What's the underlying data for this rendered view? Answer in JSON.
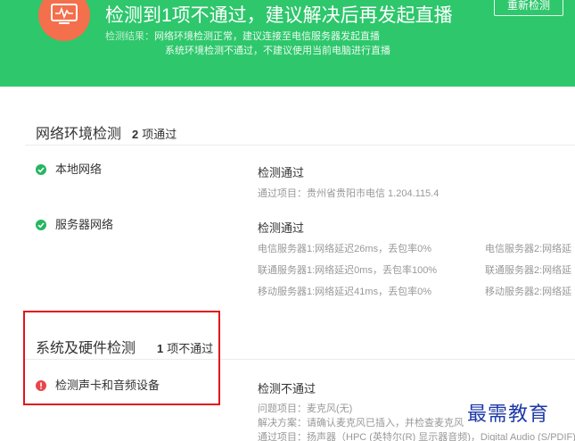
{
  "banner": {
    "title": "检测到1项不通过，建议解决后再发起直播",
    "result_label": "检测结果：",
    "result_line1": "网络环境检测正常，建议连接至电信服务器发起直播",
    "result_line2": "系统环境检测不通过，不建议使用当前电脑进行直播",
    "recheck_button": "重新检测",
    "accent_color": "#2ec76c",
    "icon_color": "#f46f4b"
  },
  "network_section": {
    "title": "网络环境检测",
    "count": "2",
    "count_suffix": "项通过",
    "items": [
      {
        "name": "本地网络",
        "status_icon": "check-circle-icon",
        "result": "检测通过",
        "details": [
          "通过项目：贵州省贵阳市电信 1.204.115.4"
        ]
      },
      {
        "name": "服务器网络",
        "status_icon": "check-circle-icon",
        "result": "检测通过",
        "details_col1": [
          "电信服务器1:网络延迟26ms，丢包率0%",
          "联通服务器1:网络延迟0ms，丢包率100%",
          "移动服务器1:网络延迟41ms，丢包率0%"
        ],
        "details_col2": [
          "电信服务器2:网络延",
          "联通服务器2:网络延",
          "移动服务器2:网络延"
        ]
      }
    ]
  },
  "system_section": {
    "title": "系统及硬件检测",
    "count": "1",
    "count_suffix": "项不通过",
    "items": [
      {
        "name": "检测声卡和音频设备",
        "status_icon": "error-circle-icon",
        "result": "检测不通过",
        "details": [
          "问题项目：麦克风(无)",
          "解决方案：请确认麦克风已插入，并检查麦克风",
          "通过项目：扬声器（HPC (英特尔(R) 显示器音频)，Digital Audio (S/PDIF)"
        ]
      }
    ]
  },
  "watermark": "最需教育",
  "colors": {
    "ok": "#25b562",
    "error": "#e8474a",
    "highlight_box": "#e3141b"
  }
}
